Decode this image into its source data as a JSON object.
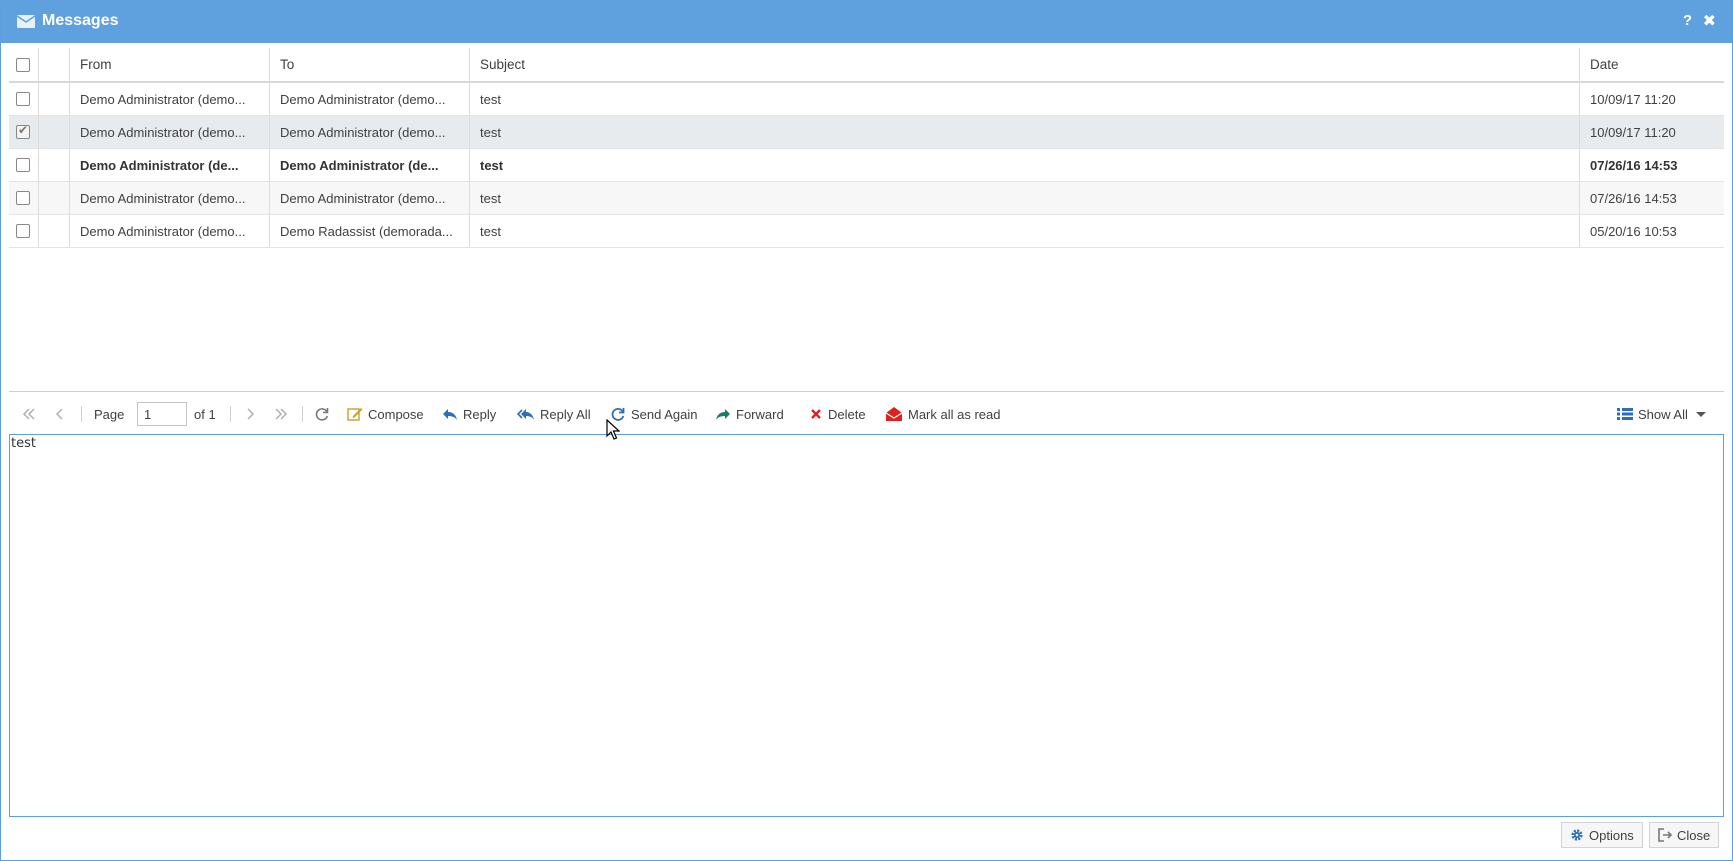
{
  "window": {
    "title": "Messages",
    "help_label": "?",
    "close_label": "✖"
  },
  "grid": {
    "headers": {
      "from": "From",
      "to": "To",
      "subject": "Subject",
      "date": "Date"
    },
    "rows": [
      {
        "from": "Demo Administrator (demo...",
        "to": "Demo Administrator (demo...",
        "subject": "test",
        "date": "10/09/17 11:20",
        "checked": false,
        "bold": false,
        "selected": false
      },
      {
        "from": "Demo Administrator (demo...",
        "to": "Demo Administrator (demo...",
        "subject": "test",
        "date": "10/09/17 11:20",
        "checked": true,
        "bold": false,
        "selected": true
      },
      {
        "from": "Demo Administrator (de...",
        "to": "Demo Administrator (de...",
        "subject": "test",
        "date": "07/26/16 14:53",
        "checked": false,
        "bold": true,
        "selected": false
      },
      {
        "from": "Demo Administrator (demo...",
        "to": "Demo Administrator (demo...",
        "subject": "test",
        "date": "07/26/16 14:53",
        "checked": false,
        "bold": false,
        "selected": false
      },
      {
        "from": "Demo Administrator (demo...",
        "to": "Demo Radassist (demorada...",
        "subject": "test",
        "date": "05/20/16 10:53",
        "checked": false,
        "bold": false,
        "selected": false
      }
    ]
  },
  "toolbar": {
    "page_label": "Page",
    "page_value": "1",
    "of_label": "of 1",
    "compose": "Compose",
    "reply": "Reply",
    "reply_all": "Reply All",
    "send_again": "Send Again",
    "forward": "Forward",
    "delete": "Delete",
    "mark_all_read": "Mark all as read",
    "show_all": "Show All"
  },
  "preview": {
    "body": "test"
  },
  "footer": {
    "options": "Options",
    "close": "Close"
  },
  "colors": {
    "titlebar": "#5fa1de",
    "accent_blue": "#2a6fb8",
    "delete_red": "#e02020",
    "compose_yellow": "#c9a227",
    "forward_teal": "#1f7a6a"
  }
}
